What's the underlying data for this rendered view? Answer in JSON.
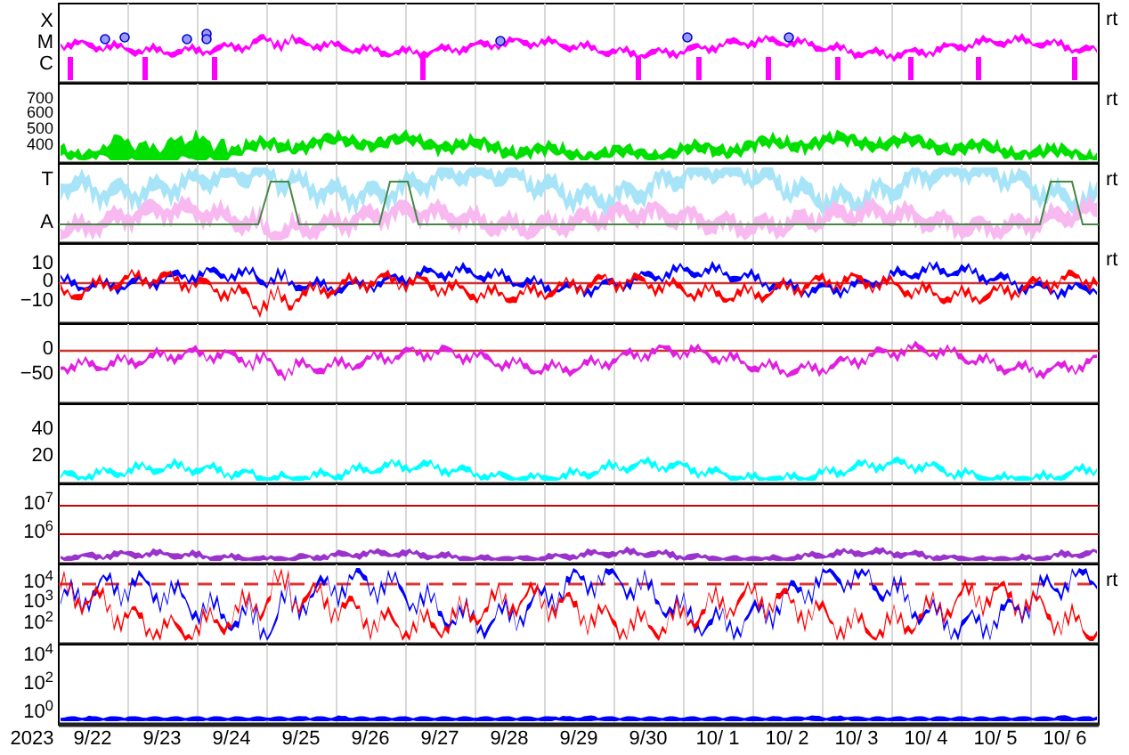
{
  "panels": [
    {
      "y_labels": [
        "X",
        "M",
        "C"
      ],
      "right_label": "rt",
      "traces": [
        {
          "color": "#ff00ff"
        }
      ]
    },
    {
      "y_labels": [
        "700",
        "600",
        "500",
        "400"
      ],
      "right_label": "rt",
      "traces": [
        {
          "color": "#00e000"
        }
      ]
    },
    {
      "y_labels": [
        "T",
        "A"
      ],
      "right_label": "rt",
      "traces": [
        {
          "color": "#a8e4f8"
        },
        {
          "color": "#f8b8f0"
        }
      ]
    },
    {
      "y_labels": [
        "10",
        "0",
        "−10"
      ],
      "right_label": "rt",
      "traces": [
        {
          "color": "#0000ff"
        },
        {
          "color": "#ff0000"
        }
      ]
    },
    {
      "y_labels": [
        "0",
        "−50"
      ],
      "traces": [
        {
          "color": "#e020e0"
        }
      ]
    },
    {
      "y_labels": [
        "40",
        "20"
      ],
      "traces": [
        {
          "color": "#00ffff"
        }
      ]
    },
    {
      "y_labels": [
        "10$^{7}$",
        "10$^{6}$"
      ],
      "traces": [
        {
          "color": "#9933cc"
        }
      ]
    },
    {
      "y_labels": [
        "10$^{4}$",
        "10$^{3}$",
        "10$^{2}$"
      ],
      "right_label": "rt",
      "traces": [
        {
          "color": "#0000ff"
        },
        {
          "color": "#ff0000"
        }
      ]
    },
    {
      "y_labels": [
        "10$^{4}$",
        "10$^{2}$",
        "10$^{0}$"
      ],
      "traces": [
        {
          "color": "#0000ff"
        }
      ]
    }
  ],
  "year": "2023",
  "x_labels": [
    "9/22",
    "9/23",
    "9/24",
    "9/25",
    "9/26",
    "9/27",
    "9/28",
    "9/29",
    "9/30",
    "10/ 1",
    "10/ 2",
    "10/ 3",
    "10/ 4",
    "10/ 5",
    "10/ 6"
  ]
}
